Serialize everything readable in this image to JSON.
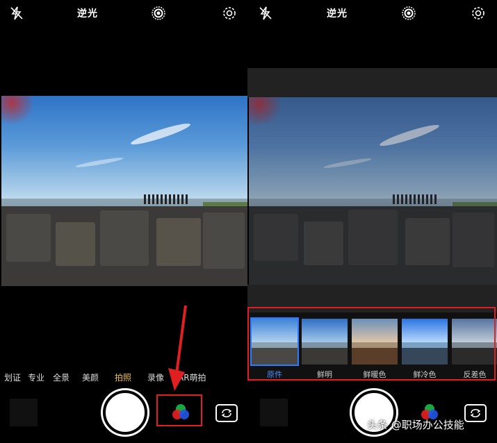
{
  "left": {
    "top_bar": {
      "flash_icon": "flash-off-icon",
      "mode_label": "逆光",
      "live_icon": "live-photo-icon",
      "settings_icon": "gear-icon"
    },
    "modes": [
      {
        "label": "划证",
        "active": false
      },
      {
        "label": "专业",
        "active": false
      },
      {
        "label": "全景",
        "active": false
      },
      {
        "label": "美颜",
        "active": false
      },
      {
        "label": "拍照",
        "active": true
      },
      {
        "label": "录像",
        "active": false
      },
      {
        "label": "AR萌拍",
        "active": false
      }
    ],
    "bottom": {
      "shutter_icon": "shutter-icon",
      "filter_icon": "filter-rgb-icon",
      "flip_icon": "switch-camera-icon"
    },
    "highlight_color": "#e02020"
  },
  "right": {
    "top_bar": {
      "flash_icon": "flash-off-icon",
      "mode_label": "逆光",
      "live_icon": "live-photo-icon",
      "settings_icon": "gear-icon"
    },
    "filters": [
      {
        "label": "原件",
        "selected": true
      },
      {
        "label": "鲜明",
        "selected": false
      },
      {
        "label": "鲜暖色",
        "selected": false
      },
      {
        "label": "鲜冷色",
        "selected": false
      },
      {
        "label": "反差色",
        "selected": false
      }
    ],
    "selected_color": "#2f7bff"
  },
  "watermark": "头条 @职场办公技能"
}
